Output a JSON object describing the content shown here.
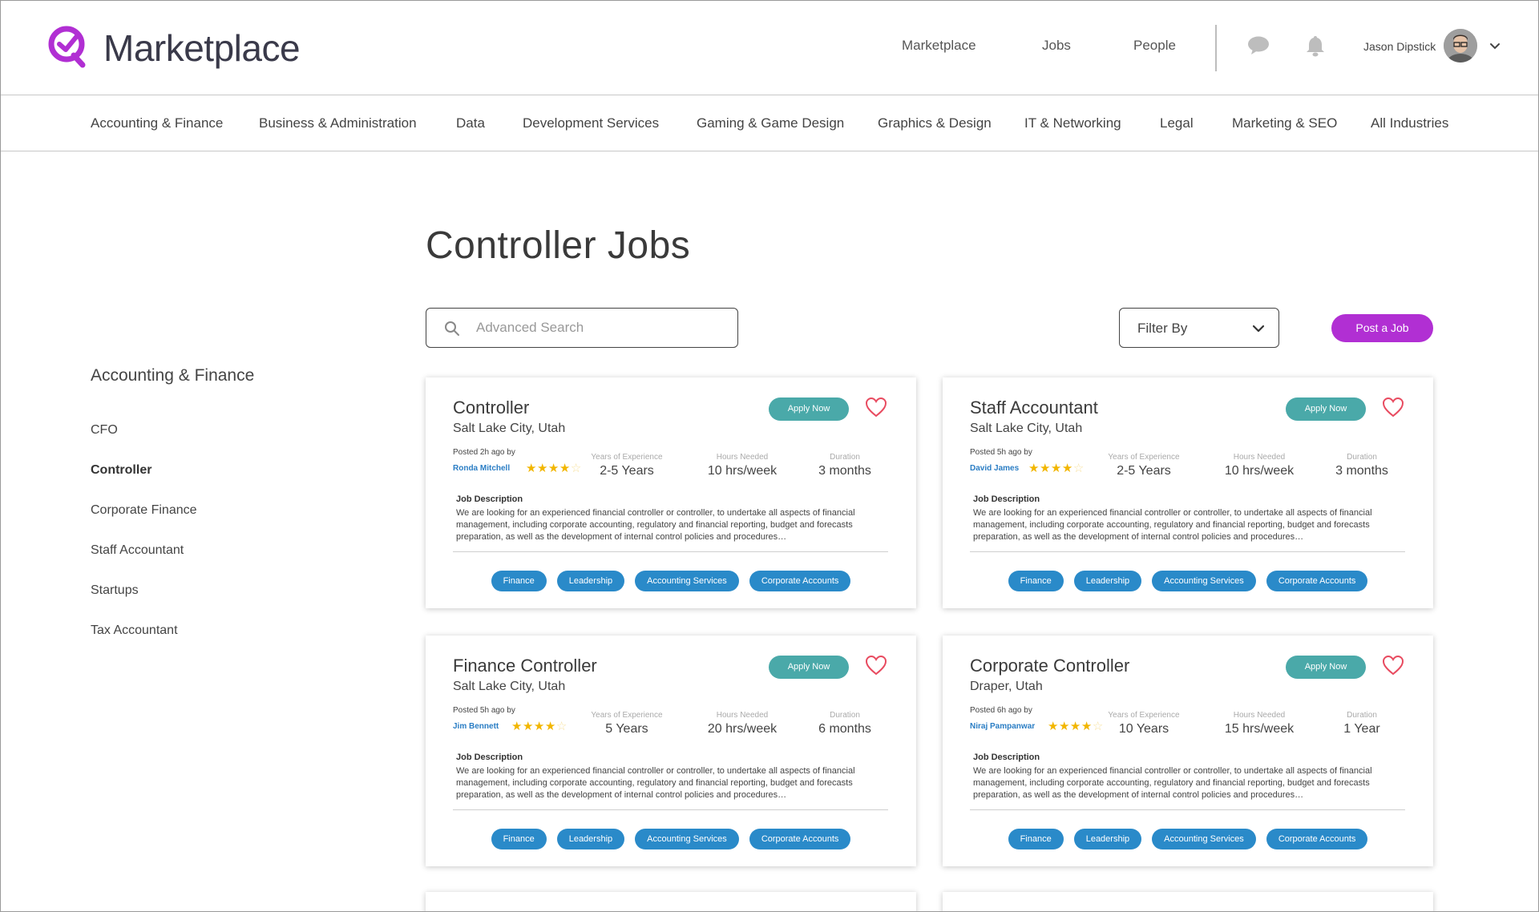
{
  "brand": {
    "name": "Marketplace",
    "accent": "#b12fd3"
  },
  "topnav": [
    {
      "label": "Marketplace"
    },
    {
      "label": "Jobs"
    },
    {
      "label": "People"
    }
  ],
  "user": {
    "name": "Jason Dipstick"
  },
  "icons": {
    "chat": "chat-bubble-icon",
    "bell": "bell-icon",
    "caret": "chevron-down-icon"
  },
  "industries": [
    {
      "label": "Accounting & Finance"
    },
    {
      "label": "Business & Administration"
    },
    {
      "label": "Data"
    },
    {
      "label": "Development Services"
    },
    {
      "label": "Gaming & Game Design"
    },
    {
      "label": "Graphics & Design"
    },
    {
      "label": "IT & Networking"
    },
    {
      "label": "Legal"
    },
    {
      "label": "Marketing & SEO"
    },
    {
      "label": "All Industries"
    }
  ],
  "sidebar": {
    "title": "Accounting & Finance",
    "items": [
      {
        "label": "CFO",
        "active": false
      },
      {
        "label": "Controller",
        "active": true
      },
      {
        "label": "Corporate Finance",
        "active": false
      },
      {
        "label": "Staff Accountant",
        "active": false
      },
      {
        "label": "Startups",
        "active": false
      },
      {
        "label": "Tax Accountant",
        "active": false
      }
    ]
  },
  "main": {
    "title": "Controller Jobs",
    "search": {
      "placeholder": "Advanced Search",
      "value": ""
    },
    "filter": {
      "label": "Filter By"
    },
    "post_button": "Post a Job"
  },
  "labels": {
    "years": "Years of Experience",
    "hours": "Hours Needed",
    "duration": "Duration",
    "description": "Job Description",
    "apply": "Apply Now"
  },
  "jobs": [
    {
      "title": "Controller",
      "location": "Salt Lake City, Utah",
      "posted": "Posted 2h ago by",
      "poster": "Ronda Mitchell",
      "rating": 4,
      "years": "2-5 Years",
      "hours": "10 hrs/week",
      "duration": "3 months",
      "description": "We are looking for an experienced financial controller or controller, to undertake all aspects of financial management, including corporate accounting, regulatory and financial reporting, budget and forecasts preparation, as well as the development of internal control policies and procedures…",
      "tags": [
        "Finance",
        "Leadership",
        "Accounting Services",
        "Corporate Accounts"
      ]
    },
    {
      "title": "Staff Accountant",
      "location": "Salt Lake City, Utah",
      "posted": "Posted 5h ago by",
      "poster": "David James",
      "rating": 4,
      "years": "2-5 Years",
      "hours": "10 hrs/week",
      "duration": "3 months",
      "description": "We are looking for an experienced financial controller or controller, to undertake all aspects of financial management, including corporate accounting, regulatory and financial reporting, budget and forecasts preparation, as well as the development of internal control policies and procedures…",
      "tags": [
        "Finance",
        "Leadership",
        "Accounting Services",
        "Corporate Accounts"
      ]
    },
    {
      "title": "Finance Controller",
      "location": "Salt Lake City, Utah",
      "posted": "Posted 5h ago by",
      "poster": "Jim Bennett",
      "rating": 4,
      "years": "5 Years",
      "hours": "20 hrs/week",
      "duration": "6 months",
      "description": "We are looking for an experienced financial controller or controller, to undertake all aspects of financial management, including corporate accounting, regulatory and financial reporting, budget and forecasts preparation, as well as the development of internal control policies and procedures…",
      "tags": [
        "Finance",
        "Leadership",
        "Accounting Services",
        "Corporate Accounts"
      ]
    },
    {
      "title": "Corporate Controller",
      "location": "Draper, Utah",
      "posted": "Posted 6h ago by",
      "poster": "Niraj Pampanwar",
      "rating": 4,
      "years": "10 Years",
      "hours": "15 hrs/week",
      "duration": "1 Year",
      "description": "We are looking for an experienced financial controller or controller, to undertake all aspects of financial management, including corporate accounting, regulatory and financial reporting, budget and forecasts preparation, as well as the development of internal control policies and procedures…",
      "tags": [
        "Finance",
        "Leadership",
        "Accounting Services",
        "Corporate Accounts"
      ]
    }
  ]
}
